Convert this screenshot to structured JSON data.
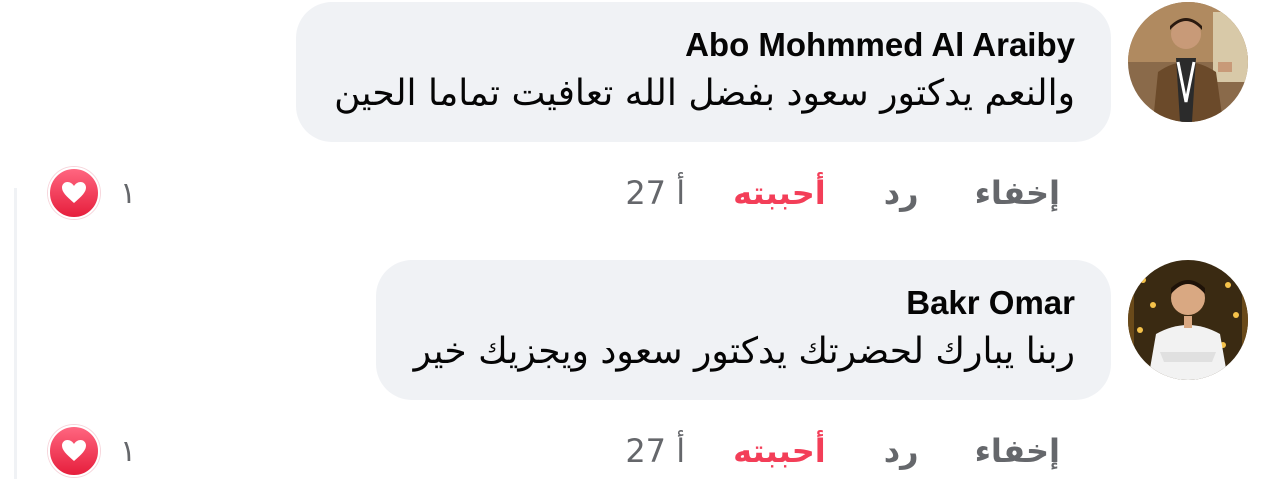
{
  "colors": {
    "bubble_bg": "#f0f2f5",
    "like_active": "#f33e58",
    "meta_text": "#65676b",
    "heart": "#f33e58"
  },
  "comments": [
    {
      "author": "Abo Mohmmed Al Araiby",
      "text": "والنعم يدكتور سعود بفضل الله تعافيت تماما الحين",
      "time": "27 أ",
      "like_label": "أحببته",
      "reply_label": "رد",
      "hide_label": "إخفاء",
      "reaction_icon": "heart-icon",
      "reaction_count": "١"
    },
    {
      "author": "Bakr Omar",
      "text": "ربنا يبارك لحضرتك يدكتور سعود ويجزيك خير",
      "time": "27 أ",
      "like_label": "أحببته",
      "reply_label": "رد",
      "hide_label": "إخفاء",
      "reaction_icon": "heart-icon",
      "reaction_count": "١"
    }
  ]
}
